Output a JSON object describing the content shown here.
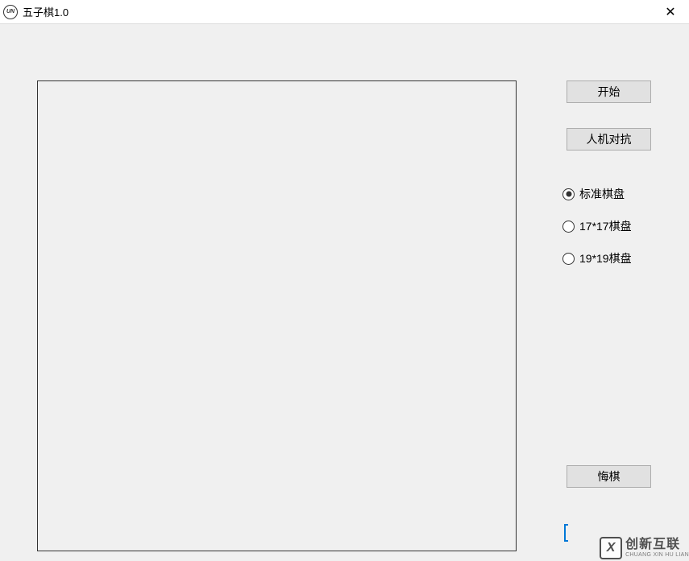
{
  "window": {
    "title": "五子棋1.0"
  },
  "buttons": {
    "start": "开始",
    "mode": "人机对抗",
    "undo": "悔棋"
  },
  "radios": {
    "options": [
      {
        "label": "标准棋盘",
        "checked": true
      },
      {
        "label": "17*17棋盘",
        "checked": false
      },
      {
        "label": "19*19棋盘",
        "checked": false
      }
    ]
  },
  "watermark": {
    "icon_letter": "X",
    "cn": "创新互联",
    "en": "CHUANG XIN HU LIAN"
  },
  "app_icon": {
    "text": "UN"
  }
}
